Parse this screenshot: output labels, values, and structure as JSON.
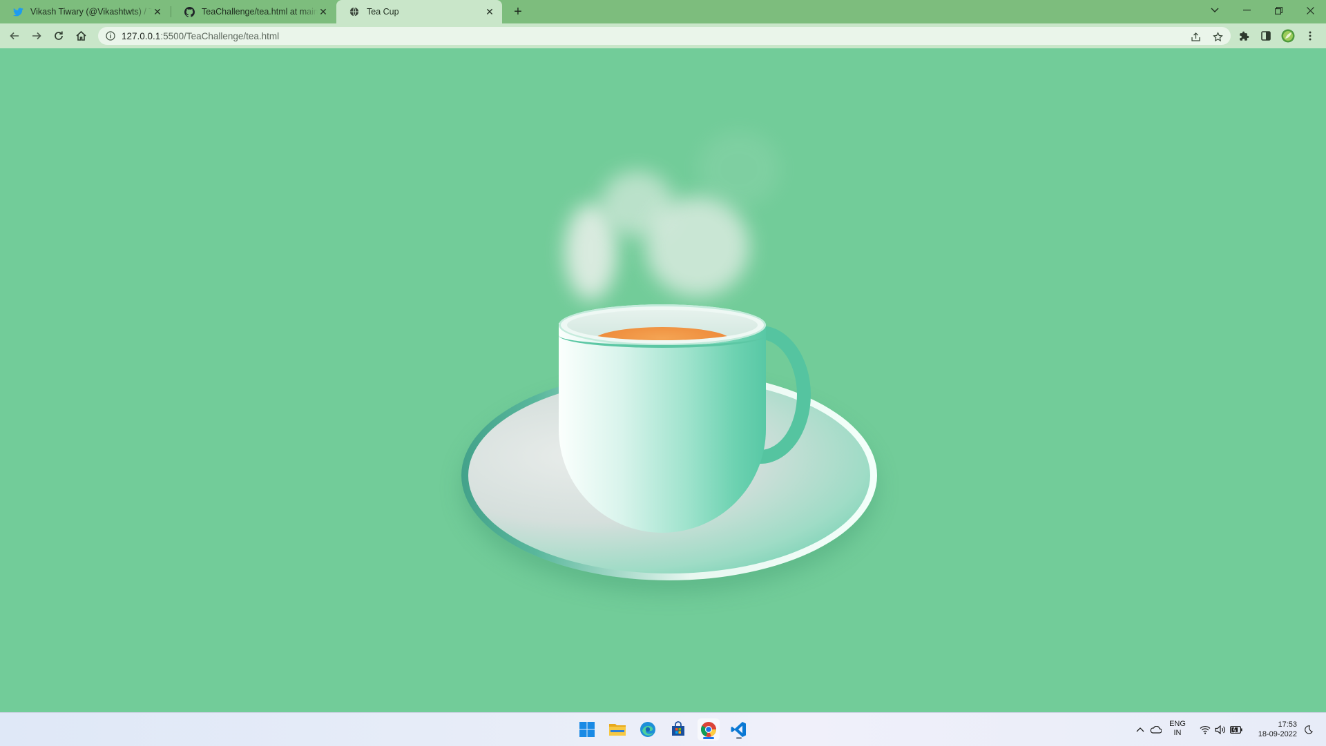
{
  "browser": {
    "tabs": [
      {
        "title": "Vikash Tiwary (@Vikashtwts) / Twitter",
        "favicon": "twitter-icon",
        "active": false
      },
      {
        "title": "TeaChallenge/tea.html at main · Vikash",
        "favicon": "github-icon",
        "active": false
      },
      {
        "title": "Tea Cup",
        "favicon": "globe-icon",
        "active": true
      }
    ],
    "address": {
      "host": "127.0.0.1",
      "path": ":5500/TeaChallenge/tea.html"
    }
  },
  "page": {
    "subject": "tea-cup-illustration",
    "colors": {
      "background": "#72cc99",
      "cup": "#58c8a5",
      "tea": "#ee8a3a",
      "saucer": "#d5dfdc"
    }
  },
  "taskbar": {
    "apps": [
      "windows-start-icon",
      "file-explorer-icon",
      "edge-icon",
      "microsoft-store-icon",
      "chrome-icon",
      "vscode-icon"
    ],
    "language": {
      "line1": "ENG",
      "line2": "IN"
    },
    "clock": {
      "time": "17:53",
      "date": "18-09-2022"
    }
  }
}
